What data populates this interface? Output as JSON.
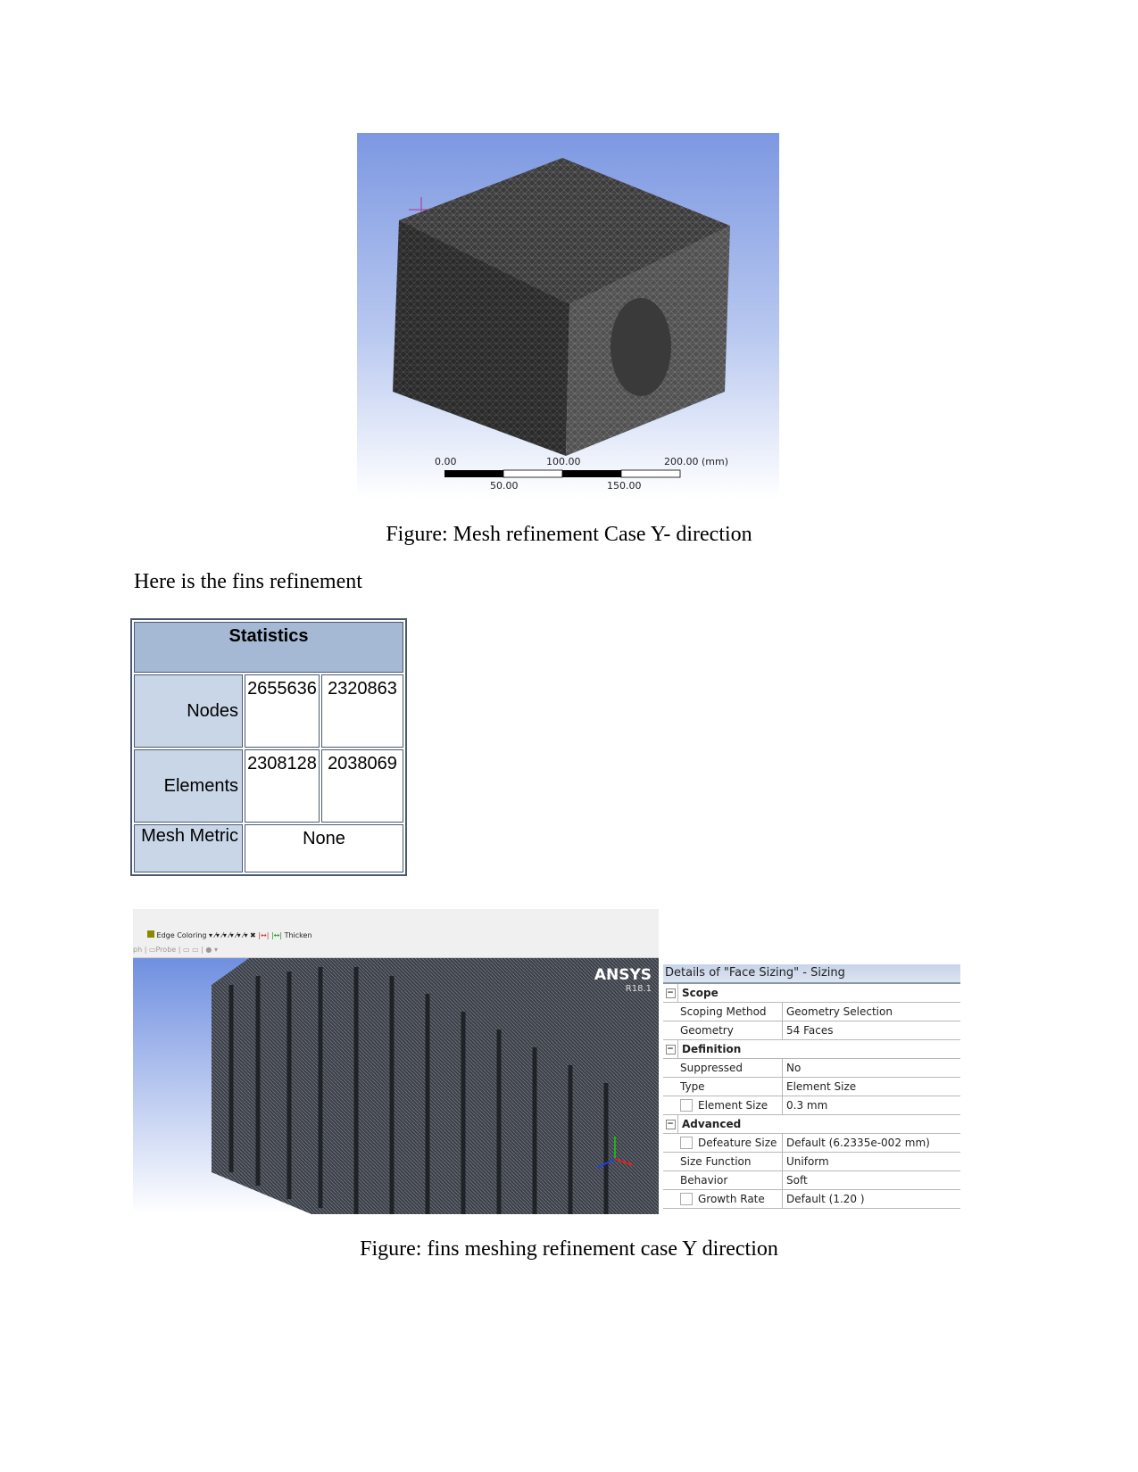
{
  "figure1": {
    "caption": "Figure: Mesh refinement Case Y- direction",
    "scale_labels_top": [
      "0.00",
      "100.00",
      "200.00 (mm)"
    ],
    "scale_labels_bottom": [
      "50.00",
      "150.00"
    ]
  },
  "paragraph": "Here is the fins refinement",
  "statistics": {
    "header": "Statistics",
    "rows": [
      {
        "label": "Nodes",
        "values": [
          "2655636",
          "2320863"
        ]
      },
      {
        "label": "Elements",
        "values": [
          "2308128",
          "2038069"
        ]
      },
      {
        "label": "Mesh Metric",
        "value": "None"
      }
    ]
  },
  "figure2": {
    "toolbar": {
      "edge_coloring": "Edge Coloring",
      "thicken": "Thicken",
      "graph_partial": "ph",
      "probe": "Probe"
    },
    "logo": "ANSYS",
    "version": "R18.1",
    "caption": "Figure: fins meshing refinement case Y direction"
  },
  "details": {
    "title": "Details of \"Face Sizing\" - Sizing",
    "sections": [
      {
        "name": "Scope",
        "rows": [
          {
            "key": "Scoping Method",
            "value": "Geometry Selection",
            "checkbox": false
          },
          {
            "key": "Geometry",
            "value": "54 Faces",
            "checkbox": false
          }
        ]
      },
      {
        "name": "Definition",
        "rows": [
          {
            "key": "Suppressed",
            "value": "No",
            "checkbox": false
          },
          {
            "key": "Type",
            "value": "Element Size",
            "checkbox": false
          },
          {
            "key": "Element Size",
            "value": "0.3 mm",
            "checkbox": true
          }
        ]
      },
      {
        "name": "Advanced",
        "rows": [
          {
            "key": "Defeature Size",
            "value": "Default (6.2335e-002 mm)",
            "checkbox": true
          },
          {
            "key": "Size Function",
            "value": "Uniform",
            "checkbox": false
          },
          {
            "key": "Behavior",
            "value": "Soft",
            "checkbox": false
          },
          {
            "key": "Growth Rate",
            "value": "Default (1.20 )",
            "checkbox": true
          }
        ]
      }
    ]
  }
}
